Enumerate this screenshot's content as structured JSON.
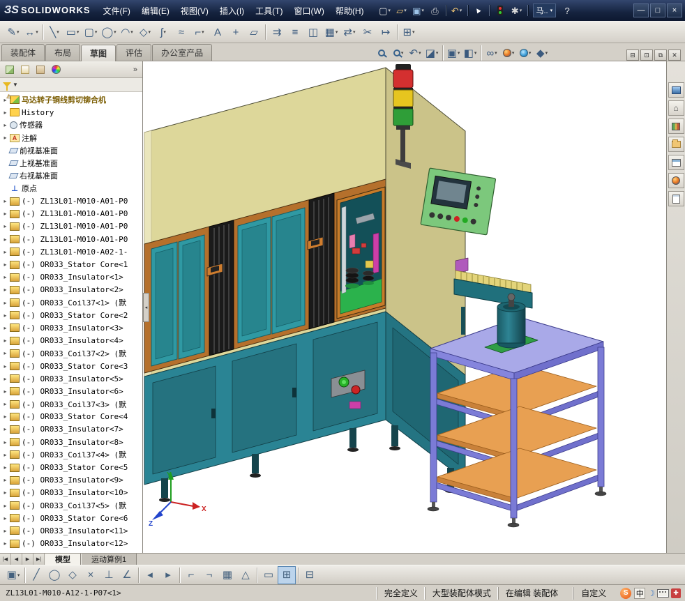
{
  "colors": {
    "titlebar": "#15233f",
    "toolbar": "#d4d0c8",
    "machine_yellow": "#ddd79a",
    "machine_teal": "#2a8494",
    "cart_purple": "#a9a9e8",
    "shelf_orange": "#e8a052",
    "signal_red": "#d43030",
    "signal_yellow": "#e6c51f",
    "signal_green": "#2f9e38"
  },
  "titlebar": {
    "logo_mark": "ЗS",
    "logo_text": "SOLIDWORKS",
    "menus": [
      "文件(F)",
      "编辑(E)",
      "视图(V)",
      "插入(I)",
      "工具(T)",
      "窗口(W)",
      "帮助(H)"
    ],
    "icons": [
      {
        "name": "new-document-icon",
        "glyph": "▢",
        "dd": true
      },
      {
        "name": "open-document-icon",
        "glyph": "▱",
        "color": "#f0c674",
        "dd": true
      },
      {
        "name": "save-icon",
        "glyph": "▣",
        "color": "#9ec4e8",
        "dd": true
      },
      {
        "name": "print-icon",
        "glyph": "⎙",
        "color": "#d8d8d8"
      },
      {
        "sep": true
      },
      {
        "name": "undo-icon",
        "glyph": "↶",
        "color": "#f0c674",
        "dd": true
      },
      {
        "sep": true
      },
      {
        "name": "select-cursor-icon",
        "glyph": "▲",
        "cls": "cursor"
      },
      {
        "sep": true
      },
      {
        "name": "rebuild-icon",
        "kind": "traffic"
      },
      {
        "name": "options-icon",
        "glyph": "✱",
        "color": "#d8d8d8",
        "dd": true
      },
      {
        "sep": true
      }
    ],
    "search_label": "马..",
    "help_label": "?",
    "window_controls": [
      {
        "name": "minimize-button",
        "glyph": "—"
      },
      {
        "name": "maximize-button",
        "glyph": "□"
      },
      {
        "name": "close-button",
        "glyph": "×"
      }
    ]
  },
  "toolbar2": {
    "icons": [
      {
        "name": "sketch-icon",
        "glyph": "✎",
        "dd": true
      },
      {
        "name": "smart-dimension-icon",
        "glyph": "↔",
        "dd": true
      },
      {
        "sep": true
      },
      {
        "name": "line-icon",
        "glyph": "╲",
        "dd": true
      },
      {
        "name": "rectangle-icon",
        "glyph": "▭",
        "dd": true
      },
      {
        "name": "slot-icon",
        "glyph": "▢",
        "dd": true
      },
      {
        "name": "circle-icon",
        "glyph": "◯",
        "dd": true
      },
      {
        "name": "arc-icon",
        "glyph": "◠",
        "dd": true
      },
      {
        "name": "polygon-icon",
        "glyph": "◇",
        "dd": true
      },
      {
        "name": "spline-icon",
        "glyph": "ʃ",
        "dd": true
      },
      {
        "name": "ellipse-icon",
        "glyph": "≈"
      },
      {
        "name": "fillet-icon",
        "glyph": "⌐",
        "dd": true
      },
      {
        "name": "text-icon",
        "glyph": "A"
      },
      {
        "name": "point-icon",
        "glyph": "+"
      },
      {
        "name": "plane-icon",
        "glyph": "▱"
      },
      {
        "sep": true
      },
      {
        "name": "convert-entities-icon",
        "glyph": "⇉"
      },
      {
        "name": "offset-entities-icon",
        "glyph": "≡"
      },
      {
        "name": "mirror-entities-icon",
        "glyph": "◫"
      },
      {
        "name": "linear-pattern-icon",
        "glyph": "▦",
        "dd": true
      },
      {
        "name": "move-entities-icon",
        "glyph": "⇄",
        "dd": true
      },
      {
        "name": "trim-entities-icon",
        "glyph": "✂"
      },
      {
        "name": "extend-entities-icon",
        "glyph": "↦"
      },
      {
        "sep": true
      },
      {
        "name": "display-grid-icon",
        "glyph": "⊞",
        "dd": true
      }
    ]
  },
  "ribbon_tabs": {
    "items": [
      {
        "label": "装配体",
        "active": false
      },
      {
        "label": "布局",
        "active": false
      },
      {
        "label": "草图",
        "active": true
      },
      {
        "label": "评估",
        "active": false
      },
      {
        "label": "办公室产品",
        "active": false
      }
    ]
  },
  "view_toolbar": {
    "icons": [
      {
        "name": "zoom-fit-icon",
        "kind": "mag"
      },
      {
        "name": "zoom-area-icon",
        "kind": "mag",
        "dd": true
      },
      {
        "name": "previous-view-icon",
        "glyph": "↶",
        "dd": true
      },
      {
        "name": "section-view-icon",
        "glyph": "◪",
        "dd": true
      },
      {
        "sep": true
      },
      {
        "name": "view-orientation-icon",
        "glyph": "▣",
        "dd": true
      },
      {
        "name": "display-style-icon",
        "glyph": "◧",
        "dd": true
      },
      {
        "sep": true
      },
      {
        "name": "hide-show-items-icon",
        "glyph": "∞",
        "dd": true
      },
      {
        "name": "edit-appearance-icon",
        "kind": "ball",
        "dd": true
      },
      {
        "name": "apply-scene-icon",
        "kind": "globe",
        "dd": true
      },
      {
        "name": "view-settings-icon",
        "glyph": "◆",
        "dd": true
      }
    ]
  },
  "doc_window_controls": [
    {
      "name": "doc-minimize-icon",
      "glyph": "⊟"
    },
    {
      "name": "doc-restore-icon",
      "glyph": "⊡"
    },
    {
      "name": "doc-cascade-icon",
      "glyph": "⧉"
    },
    {
      "name": "doc-close-icon",
      "glyph": "✕"
    }
  ],
  "panel_header": {
    "icons": [
      {
        "name": "featuremanager-tree-icon",
        "kind": "tree"
      },
      {
        "name": "property-manager-icon",
        "kind": "props"
      },
      {
        "name": "configuration-manager-icon",
        "kind": "config"
      },
      {
        "name": "display-manager-icon",
        "kind": "display"
      }
    ],
    "chevron": "»"
  },
  "tree": {
    "items": [
      {
        "type": "assembly",
        "label": "马达转子铜线剪切铆合机",
        "arrow": true,
        "root": true,
        "warning": true
      },
      {
        "type": "history",
        "label": "History",
        "arrow": true
      },
      {
        "type": "sensors",
        "label": "传感器",
        "arrow": true
      },
      {
        "type": "annotations",
        "label": "注解",
        "arrow": true
      },
      {
        "type": "plane",
        "label": "前视基准面",
        "arrow": false
      },
      {
        "type": "plane",
        "label": "上视基准面",
        "arrow": false
      },
      {
        "type": "plane",
        "label": "右视基准面",
        "arrow": false
      },
      {
        "type": "origin",
        "label": "原点",
        "arrow": false
      },
      {
        "type": "component",
        "label": "(-) ZL13L01-M010-A01-P0",
        "arrow": true
      },
      {
        "type": "component",
        "label": "(-) ZL13L01-M010-A01-P0",
        "arrow": true
      },
      {
        "type": "component",
        "label": "(-) ZL13L01-M010-A01-P0",
        "arrow": true
      },
      {
        "type": "component",
        "label": "(-) ZL13L01-M010-A01-P0",
        "arrow": true
      },
      {
        "type": "component",
        "label": "(-) ZL13L01-M010-A02-1-",
        "arrow": true
      },
      {
        "type": "component",
        "label": "(-) OR033_Stator Core<1",
        "arrow": true
      },
      {
        "type": "component",
        "label": "(-) OR033_Insulator<1>",
        "arrow": true
      },
      {
        "type": "component",
        "label": "(-) OR033_Insulator<2>",
        "arrow": true
      },
      {
        "type": "component",
        "label": "(-) OR033_Coil37<1> (默",
        "arrow": true
      },
      {
        "type": "component",
        "label": "(-) OR033_Stator Core<2",
        "arrow": true
      },
      {
        "type": "component",
        "label": "(-) OR033_Insulator<3>",
        "arrow": true
      },
      {
        "type": "component",
        "label": "(-) OR033_Insulator<4>",
        "arrow": true
      },
      {
        "type": "component",
        "label": "(-) OR033_Coil37<2> (默",
        "arrow": true
      },
      {
        "type": "component",
        "label": "(-) OR033_Stator Core<3",
        "arrow": true
      },
      {
        "type": "component",
        "label": "(-) OR033_Insulator<5>",
        "arrow": true
      },
      {
        "type": "component",
        "label": "(-) OR033_Insulator<6>",
        "arrow": true
      },
      {
        "type": "component",
        "label": "(-) OR033_Coil37<3> (默",
        "arrow": true
      },
      {
        "type": "component",
        "label": "(-) OR033_Stator Core<4",
        "arrow": true
      },
      {
        "type": "component",
        "label": "(-) OR033_Insulator<7>",
        "arrow": true
      },
      {
        "type": "component",
        "label": "(-) OR033_Insulator<8>",
        "arrow": true
      },
      {
        "type": "component",
        "label": "(-) OR033_Coil37<4> (默",
        "arrow": true
      },
      {
        "type": "component",
        "label": "(-) OR033_Stator Core<5",
        "arrow": true
      },
      {
        "type": "component",
        "label": "(-) OR033_Insulator<9>",
        "arrow": true
      },
      {
        "type": "component",
        "label": "(-) OR033_Insulator<10>",
        "arrow": true
      },
      {
        "type": "component",
        "label": "(-) OR033_Coil37<5> (默",
        "arrow": true
      },
      {
        "type": "component",
        "label": "(-) OR033_Stator Core<6",
        "arrow": true
      },
      {
        "type": "component",
        "label": "(-) OR033_Insulator<11>",
        "arrow": true
      },
      {
        "type": "component",
        "label": "(-) OR033_Insulator<12>",
        "arrow": true
      }
    ]
  },
  "taskpane": {
    "icons": [
      {
        "name": "solidworks-resources-icon",
        "kind": "screen"
      },
      {
        "name": "home-icon",
        "glyph": "⌂"
      },
      {
        "name": "design-library-icon",
        "kind": "books"
      },
      {
        "name": "file-explorer-icon",
        "kind": "folder"
      },
      {
        "name": "view-palette-icon",
        "kind": "palette"
      },
      {
        "name": "appearances-icon",
        "kind": "ball"
      },
      {
        "name": "custom-properties-icon",
        "kind": "sheet"
      }
    ]
  },
  "viewport": {
    "triad": {
      "x": "X",
      "y": "Y",
      "z": "Z"
    },
    "splitter": "◂"
  },
  "bottom_tabs": {
    "nav": [
      {
        "name": "nav-first-button",
        "glyph": "|◀"
      },
      {
        "name": "nav-prev-button",
        "glyph": "◀"
      },
      {
        "name": "nav-next-button",
        "glyph": "▶"
      },
      {
        "name": "nav-last-button",
        "glyph": "▶|"
      }
    ],
    "tabs": [
      {
        "label": "模型",
        "active": true
      },
      {
        "label": "运动算例1",
        "active": false
      }
    ]
  },
  "toolbar3": {
    "icons": [
      {
        "name": "save-icon",
        "glyph": "▣",
        "dd": true
      },
      {
        "sep": true
      },
      {
        "name": "sketch-line-icon",
        "glyph": "╱"
      },
      {
        "name": "sketch-circle-icon",
        "glyph": "◯"
      },
      {
        "name": "sketch-polygon-icon",
        "glyph": "◇"
      },
      {
        "name": "sketch-erase-icon",
        "glyph": "×"
      },
      {
        "name": "perpendicular-relation-icon",
        "glyph": "⊥"
      },
      {
        "name": "angle-relation-icon",
        "glyph": "∠"
      },
      {
        "sep": true
      },
      {
        "name": "prev-sketch-icon",
        "glyph": "◂"
      },
      {
        "name": "next-sketch-icon",
        "glyph": "▸"
      },
      {
        "sep": true
      },
      {
        "name": "corner-snap-icon",
        "glyph": "⌐"
      },
      {
        "name": "corner-snap2-icon",
        "glyph": "¬"
      },
      {
        "name": "grid-snap-icon",
        "glyph": "▦"
      },
      {
        "name": "angle-snap-icon",
        "glyph": "△"
      },
      {
        "sep": true
      },
      {
        "name": "viewport-pane-icon",
        "glyph": "▭"
      },
      {
        "name": "viewport-pane-active-icon",
        "glyph": "⊞",
        "active": true
      },
      {
        "sep": true
      },
      {
        "name": "grid-options-icon",
        "glyph": "⊟"
      }
    ]
  },
  "statusbar": {
    "selection": "ZL13L01-M010-A12-1-P07<1>",
    "panes": [
      "完全定义",
      "大型装配体模式",
      "在编辑 装配体"
    ],
    "custom": "自定义",
    "ime": {
      "sogou": "S",
      "lang": "中",
      "wrench": "✚"
    }
  }
}
